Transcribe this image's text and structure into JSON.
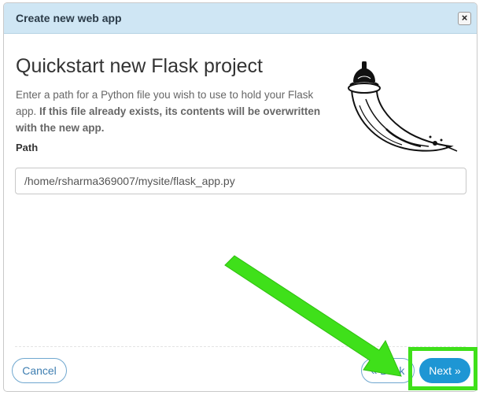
{
  "dialog": {
    "title": "Create new web app",
    "close_label": "×"
  },
  "content": {
    "heading": "Quickstart new Flask project",
    "description_plain": "Enter a path for a Python file you wish to use to hold your Flask app. ",
    "description_bold": "If this file already exists, its contents will be overwritten with the new app.",
    "path_label": "Path",
    "path_value": "/home/rsharma369007/mysite/flask_app.py"
  },
  "footer": {
    "cancel_label": "Cancel",
    "back_label": "« Back",
    "next_label": "Next »"
  },
  "colors": {
    "title_bar": "#cfe6f4",
    "primary_button": "#1e96d4",
    "highlight_annotation": "#3fe01a"
  },
  "icons": [
    "close-icon",
    "flask-logo-icon",
    "annotation-arrow-icon"
  ]
}
